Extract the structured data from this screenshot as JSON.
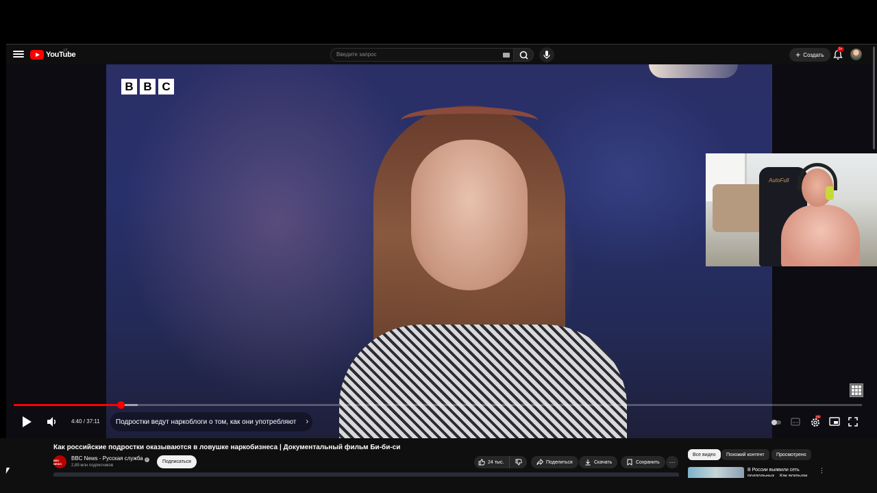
{
  "masthead": {
    "logo_text": "YouTube",
    "region": "LT",
    "search_placeholder": "Введите запрос",
    "create_label": "Создать",
    "notifications_badge": "9+"
  },
  "player": {
    "progress": {
      "played_fraction": 0.126,
      "buffered_fraction": 0.146
    },
    "time_current": "4:40",
    "time_total": "37:11",
    "time_display": "4:40 / 37:11",
    "chapter_title": "Подростки ведут наркоблоги о том, как они употребляют",
    "brand_logo": [
      "B",
      "B",
      "C"
    ],
    "settings_badge": "HD",
    "overlay_label": "AutoFull"
  },
  "video": {
    "title": "Как российские подростки оказываются в ловушке наркобизнеса | Документальный фильм Би-би-си",
    "channel_name": "BBC News - Русская служба",
    "channel_avatar_text": "BBC NEWS",
    "subscribers": "2,89 млн подписчиков",
    "subscribe_label": "Подписаться",
    "likes": "24 тыс.",
    "share_label": "Поделиться",
    "download_label": "Скачать",
    "save_label": "Сохранить"
  },
  "sidebar": {
    "chips": [
      "Все видео",
      "Похожий контент",
      "Просмотрено"
    ],
    "active_chip": "Все видео",
    "recommendation_title": "В России выявили сеть подпольных... Как вскрыли"
  },
  "colors": {
    "accent": "#ff0000",
    "background": "#0f0f0f",
    "chip_active": "#f1f1f1"
  }
}
